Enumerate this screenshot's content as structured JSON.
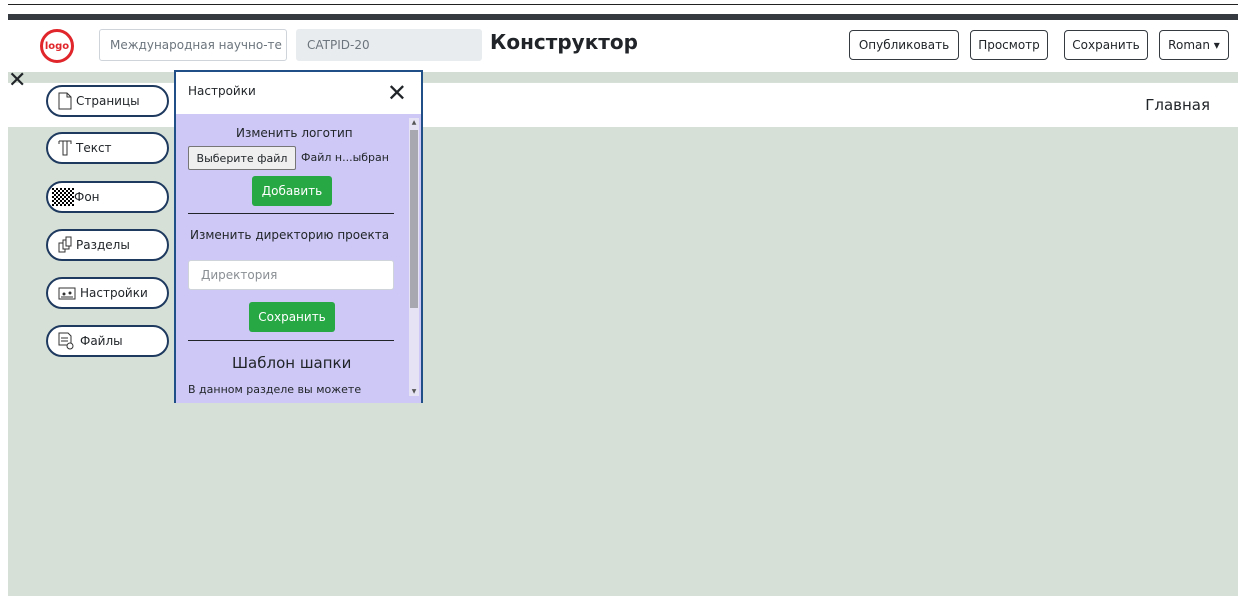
{
  "header": {
    "logo_text": "logo",
    "project_name": "Международная научно-те",
    "project_code": "CATPID-20",
    "title": "Конструктор",
    "publish_label": "Опубликовать",
    "preview_label": "Просмотр",
    "save_label": "Сохранить",
    "user_label": "Roman ▾"
  },
  "breadcrumb": {
    "current": "Главная"
  },
  "sidebar": {
    "close_glyph": "✕",
    "items": [
      {
        "label": "Страницы",
        "icon": "page-icon"
      },
      {
        "label": "Текст",
        "icon": "text-icon"
      },
      {
        "label": "Фон",
        "icon": "checker-icon"
      },
      {
        "label": "Разделы",
        "icon": "sections-icon"
      },
      {
        "label": "Настройки",
        "icon": "settings-icon"
      },
      {
        "label": "Файлы",
        "icon": "files-icon"
      }
    ]
  },
  "settings_panel": {
    "title": "Настройки",
    "close_glyph": "✕",
    "logo_label": "Изменить логотип",
    "file_button": "Выберите файл",
    "file_status": "Файл н...ыбран",
    "add_button": "Добавить",
    "dir_label": "Изменить директорию проекта",
    "dir_placeholder": "Директория",
    "save_button": "Сохранить",
    "header_template_title": "Шаблон шапки",
    "header_template_desc": "В данном разделе вы можете"
  },
  "colors": {
    "accent_green": "#28a745",
    "panel_bg": "#cdc8f5",
    "canvas_bg": "#d6e0d6",
    "nav_border": "#1f3a5f",
    "logo_red": "#e0262b"
  }
}
